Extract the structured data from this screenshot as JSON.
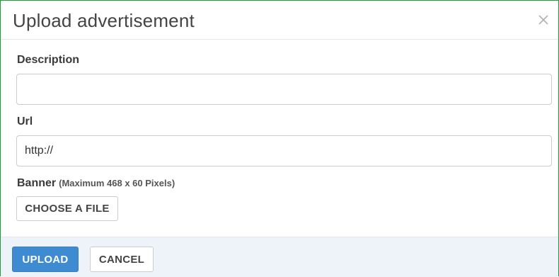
{
  "dialog": {
    "title": "Upload advertisement",
    "close_icon": "close-icon"
  },
  "form": {
    "description": {
      "label": "Description",
      "value": "",
      "placeholder": ""
    },
    "url": {
      "label": "Url",
      "value": "http://"
    },
    "banner": {
      "label": "Banner",
      "hint": "(Maximum 468 x 60 Pixels)",
      "choose_file_label": "CHOOSE A FILE"
    }
  },
  "footer": {
    "upload_label": "UPLOAD",
    "cancel_label": "CANCEL"
  },
  "colors": {
    "primary": "#3f8bd1",
    "footer_bg": "#eef3f9",
    "frame_border": "#1e9c3a"
  }
}
